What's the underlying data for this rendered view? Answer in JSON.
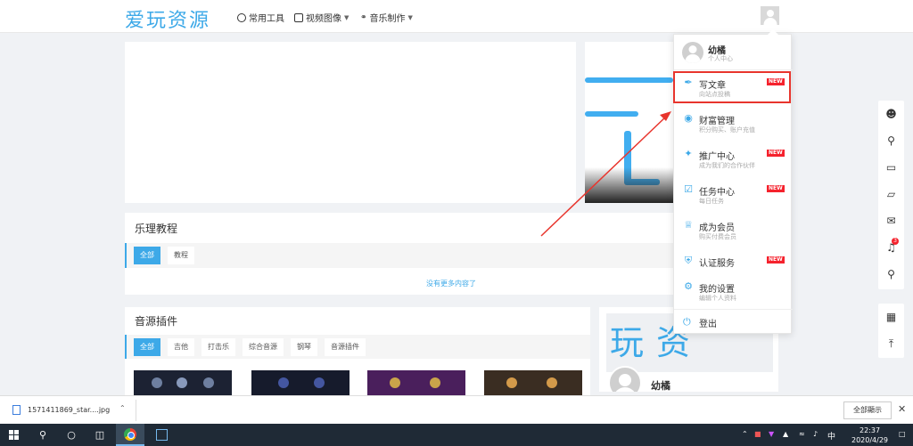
{
  "header": {
    "logo": "爱玩资源",
    "nav": [
      {
        "label": "常用工具",
        "icon": "globe-icon",
        "has_dropdown": false
      },
      {
        "label": "视频图像",
        "icon": "image-icon",
        "has_dropdown": true
      },
      {
        "label": "音乐制作",
        "icon": "headphones-icon",
        "has_dropdown": true
      }
    ]
  },
  "section1": {
    "title": "乐理教程",
    "chips": [
      "全部",
      "教程"
    ],
    "more_text": "没有更多内容了"
  },
  "section2": {
    "title": "音源插件",
    "chips": [
      "全部",
      "吉他",
      "打击乐",
      "综合音源",
      "钢琴",
      "音源插件"
    ]
  },
  "side_card": {
    "brand": "玩资",
    "name": "幼橘"
  },
  "dropdown": {
    "user_name": "幼橘",
    "user_sub": "个人中心",
    "items": [
      {
        "title": "写文章",
        "subtitle": "向站点投稿",
        "icon": "pen-icon",
        "badge": "NEW"
      },
      {
        "title": "财富管理",
        "subtitle": "积分购买、账户充值",
        "icon": "money-bag-icon",
        "badge": ""
      },
      {
        "title": "推广中心",
        "subtitle": "成为我们的合作伙伴",
        "icon": "share-icon",
        "badge": "NEW"
      },
      {
        "title": "任务中心",
        "subtitle": "每日任务",
        "icon": "checkbox-icon",
        "badge": "NEW"
      },
      {
        "title": "成为会员",
        "subtitle": "购买付费会员",
        "icon": "crown-icon",
        "badge": ""
      },
      {
        "title": "认证服务",
        "subtitle": "",
        "icon": "shield-icon",
        "badge": "NEW"
      },
      {
        "title": "我的设置",
        "subtitle": "编辑个人资料",
        "icon": "gear-icon",
        "badge": ""
      }
    ],
    "logout": "登出"
  },
  "right_toolbar": {
    "notification_count": "3"
  },
  "download_bar": {
    "file_name": "1571411869_star....jpg",
    "show_all": "全部顯示"
  },
  "taskbar": {
    "tray_ime": "中",
    "time": "22:37",
    "date": "2020/4/29"
  },
  "colors": {
    "accent": "#3da9e8",
    "badge_red": "#f5222d",
    "highlight_red": "#e8352d",
    "taskbar": "#1f2a36"
  }
}
